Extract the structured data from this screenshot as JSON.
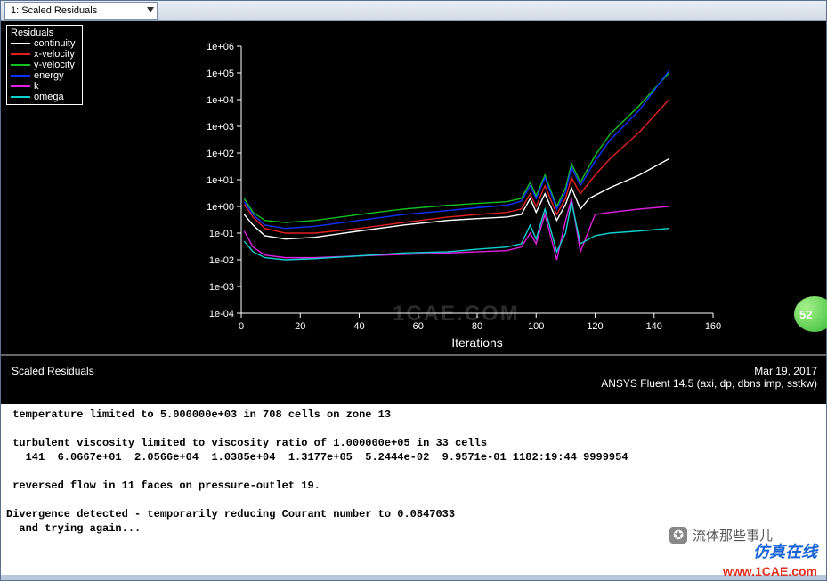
{
  "toolbar": {
    "dropdown_label": "1: Scaled Residuals"
  },
  "legend": {
    "title": "Residuals",
    "items": [
      {
        "label": "continuity",
        "color": "#ffffff"
      },
      {
        "label": "x-velocity",
        "color": "#e02020"
      },
      {
        "label": "y-velocity",
        "color": "#10c020"
      },
      {
        "label": "energy",
        "color": "#1030ff"
      },
      {
        "label": "k",
        "color": "#e020e0"
      },
      {
        "label": "omega",
        "color": "#10d0d0"
      }
    ]
  },
  "footer": {
    "left": "Scaled Residuals",
    "date": "Mar 19, 2017",
    "product": "ANSYS Fluent 14.5 (axi, dp, dbns imp, sstkw)"
  },
  "console_lines": [
    " temperature limited to 5.000000e+03 in 708 cells on zone 13",
    "",
    " turbulent viscosity limited to viscosity ratio of 1.000000e+05 in 33 cells",
    "   141  6.0667e+01  2.0566e+04  1.0385e+04  1.3177e+05  5.2444e-02  9.9571e-01 1182:19:44 9999954",
    "",
    " reversed flow in 11 faces on pressure-outlet 19.",
    "",
    "Divergence detected - temporarily reducing Courant number to 0.0847033",
    "  and trying again..."
  ],
  "watermarks": {
    "chart": "1CAE.COM",
    "wechat": "流体那些事儿",
    "site_cn": "仿真在线",
    "site_url": "www.1CAE.com"
  },
  "badge": "52",
  "chart_data": {
    "type": "line",
    "title": "",
    "xlabel": "Iterations",
    "ylabel": "",
    "xlim": [
      0,
      160
    ],
    "ylim_log10": [
      -4,
      6
    ],
    "xticks": [
      0,
      20,
      40,
      60,
      80,
      100,
      120,
      140,
      160
    ],
    "ytick_labels": [
      "1e-04",
      "1e-03",
      "1e-02",
      "1e-01",
      "1e+00",
      "1e+01",
      "1e+02",
      "1e+03",
      "1e+04",
      "1e+05",
      "1e+06"
    ],
    "log_y": true,
    "series": [
      {
        "name": "continuity",
        "color": "#ffffff",
        "points": [
          [
            1,
            0.5
          ],
          [
            4,
            0.2
          ],
          [
            8,
            0.08
          ],
          [
            15,
            0.06
          ],
          [
            25,
            0.07
          ],
          [
            40,
            0.12
          ],
          [
            55,
            0.2
          ],
          [
            70,
            0.3
          ],
          [
            80,
            0.35
          ],
          [
            90,
            0.4
          ],
          [
            95,
            0.5
          ],
          [
            98,
            2.0
          ],
          [
            100,
            0.6
          ],
          [
            103,
            3.0
          ],
          [
            107,
            0.3
          ],
          [
            110,
            1.2
          ],
          [
            112,
            5.0
          ],
          [
            115,
            0.8
          ],
          [
            118,
            2.0
          ],
          [
            125,
            5.0
          ],
          [
            135,
            15
          ],
          [
            145,
            60
          ]
        ]
      },
      {
        "name": "x-velocity",
        "color": "#e02020",
        "points": [
          [
            1,
            1.2
          ],
          [
            4,
            0.4
          ],
          [
            8,
            0.15
          ],
          [
            15,
            0.1
          ],
          [
            25,
            0.1
          ],
          [
            40,
            0.15
          ],
          [
            55,
            0.25
          ],
          [
            70,
            0.4
          ],
          [
            80,
            0.5
          ],
          [
            90,
            0.6
          ],
          [
            95,
            0.8
          ],
          [
            98,
            3.0
          ],
          [
            100,
            1.0
          ],
          [
            103,
            6.0
          ],
          [
            107,
            0.5
          ],
          [
            110,
            2.0
          ],
          [
            112,
            12
          ],
          [
            115,
            3.0
          ],
          [
            120,
            15
          ],
          [
            125,
            60
          ],
          [
            135,
            600
          ],
          [
            145,
            10000
          ]
        ]
      },
      {
        "name": "y-velocity",
        "color": "#10c020",
        "points": [
          [
            1,
            2.0
          ],
          [
            4,
            0.6
          ],
          [
            8,
            0.3
          ],
          [
            15,
            0.25
          ],
          [
            25,
            0.3
          ],
          [
            40,
            0.5
          ],
          [
            55,
            0.8
          ],
          [
            70,
            1.1
          ],
          [
            80,
            1.3
          ],
          [
            90,
            1.5
          ],
          [
            95,
            2.0
          ],
          [
            98,
            8.0
          ],
          [
            100,
            2.5
          ],
          [
            103,
            15
          ],
          [
            107,
            1.0
          ],
          [
            110,
            5.0
          ],
          [
            112,
            40
          ],
          [
            115,
            8.0
          ],
          [
            120,
            80
          ],
          [
            125,
            500
          ],
          [
            135,
            6000
          ],
          [
            145,
            100000
          ]
        ]
      },
      {
        "name": "energy",
        "color": "#1030ff",
        "points": [
          [
            1,
            1.5
          ],
          [
            4,
            0.5
          ],
          [
            8,
            0.2
          ],
          [
            15,
            0.15
          ],
          [
            25,
            0.18
          ],
          [
            40,
            0.3
          ],
          [
            55,
            0.5
          ],
          [
            70,
            0.7
          ],
          [
            80,
            0.9
          ],
          [
            90,
            1.1
          ],
          [
            95,
            1.6
          ],
          [
            98,
            6.0
          ],
          [
            100,
            2.0
          ],
          [
            103,
            12
          ],
          [
            107,
            0.8
          ],
          [
            110,
            3.5
          ],
          [
            112,
            30
          ],
          [
            115,
            6.0
          ],
          [
            120,
            50
          ],
          [
            125,
            300
          ],
          [
            135,
            4000
          ],
          [
            145,
            120000
          ]
        ]
      },
      {
        "name": "k",
        "color": "#e020e0",
        "points": [
          [
            1,
            0.12
          ],
          [
            4,
            0.03
          ],
          [
            8,
            0.015
          ],
          [
            15,
            0.012
          ],
          [
            25,
            0.012
          ],
          [
            40,
            0.014
          ],
          [
            55,
            0.016
          ],
          [
            70,
            0.018
          ],
          [
            80,
            0.02
          ],
          [
            90,
            0.022
          ],
          [
            95,
            0.03
          ],
          [
            98,
            0.1
          ],
          [
            100,
            0.04
          ],
          [
            103,
            0.5
          ],
          [
            107,
            0.01
          ],
          [
            110,
            0.3
          ],
          [
            112,
            2.0
          ],
          [
            115,
            0.02
          ],
          [
            120,
            0.5
          ],
          [
            125,
            0.6
          ],
          [
            135,
            0.8
          ],
          [
            145,
            1.0
          ]
        ]
      },
      {
        "name": "omega",
        "color": "#10d0d0",
        "points": [
          [
            1,
            0.05
          ],
          [
            4,
            0.02
          ],
          [
            8,
            0.012
          ],
          [
            15,
            0.01
          ],
          [
            25,
            0.011
          ],
          [
            40,
            0.014
          ],
          [
            55,
            0.018
          ],
          [
            70,
            0.02
          ],
          [
            80,
            0.025
          ],
          [
            90,
            0.03
          ],
          [
            95,
            0.04
          ],
          [
            98,
            0.2
          ],
          [
            100,
            0.06
          ],
          [
            103,
            0.8
          ],
          [
            107,
            0.02
          ],
          [
            110,
            0.1
          ],
          [
            112,
            1.5
          ],
          [
            115,
            0.04
          ],
          [
            120,
            0.08
          ],
          [
            125,
            0.1
          ],
          [
            135,
            0.12
          ],
          [
            145,
            0.15
          ]
        ]
      }
    ]
  }
}
